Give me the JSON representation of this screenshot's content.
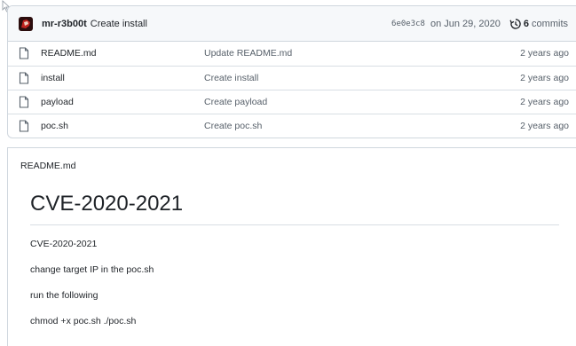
{
  "commit": {
    "author": "mr-r3b00t",
    "message": "Create install",
    "sha": "6e0e3c8",
    "date": "on Jun 29, 2020",
    "count": "6",
    "count_label": " commits"
  },
  "files": [
    {
      "name": "README.md",
      "message": "Update README.md",
      "age": "2 years ago"
    },
    {
      "name": "install",
      "message": "Create install",
      "age": "2 years ago"
    },
    {
      "name": "payload",
      "message": "Create payload",
      "age": "2 years ago"
    },
    {
      "name": "poc.sh",
      "message": "Create poc.sh",
      "age": "2 years ago"
    }
  ],
  "readme": {
    "file_title": "README.md",
    "heading": "CVE-2020-2021",
    "paragraphs": [
      "CVE-2020-2021",
      "change target IP in the poc.sh",
      "run the following",
      "chmod +x poc.sh ./poc.sh"
    ]
  },
  "icons": {
    "avatar": "avatar",
    "file": "file-icon",
    "history": "history-icon",
    "cursor": "cursor-icon"
  },
  "colors": {
    "border": "#d0d7de",
    "muted": "#57606a",
    "header_bg": "#f6f8fa",
    "avatar_red": "#c0231e"
  }
}
